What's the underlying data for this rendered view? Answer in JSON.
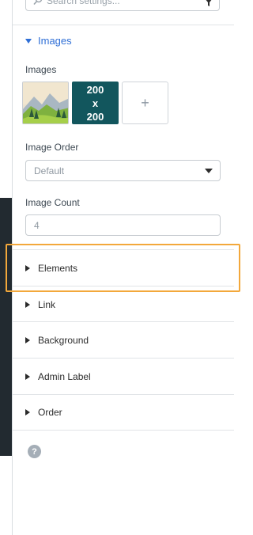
{
  "search": {
    "placeholder": "Search settings..."
  },
  "images_section": {
    "title": "Images",
    "field_label": "Images",
    "thumbnails": [
      {
        "kind": "landscape-image",
        "text": ""
      },
      {
        "kind": "placeholder-image",
        "text": "200\nx\n200"
      }
    ],
    "add_label": "+"
  },
  "image_order": {
    "label": "Image Order",
    "value": "Default"
  },
  "image_count": {
    "label": "Image Count",
    "value": "4"
  },
  "sections": [
    {
      "label": "Elements"
    },
    {
      "label": "Link"
    },
    {
      "label": "Background"
    },
    {
      "label": "Admin Label"
    },
    {
      "label": "Order"
    }
  ],
  "help": {
    "label": "?"
  },
  "colors": {
    "accent": "#2f6fd6",
    "highlight": "#f3a83b",
    "thumb_bg": "#12565d"
  }
}
